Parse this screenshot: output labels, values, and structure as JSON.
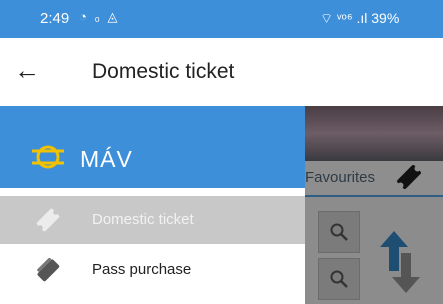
{
  "status_bar": {
    "time": "2:49",
    "icons_left": "◔ ₀ ◬",
    "right": "⌔ ᵛᵒ⁶ .ıl 39%"
  },
  "app_bar": {
    "back_icon": "arrow-left-icon",
    "title": "Domestic ticket"
  },
  "drawer": {
    "brand": "MÁV",
    "items": [
      {
        "label": "Domestic ticket",
        "icon": "ticket-icon",
        "active": true
      },
      {
        "label": "Pass purchase",
        "icon": "pass-icon",
        "active": false
      }
    ]
  },
  "background": {
    "favourites_label": "Favourites"
  },
  "colors": {
    "accent": "#3c8fd8",
    "logo_yellow": "#f2c200",
    "active_item_bg": "#c8c8c8"
  }
}
